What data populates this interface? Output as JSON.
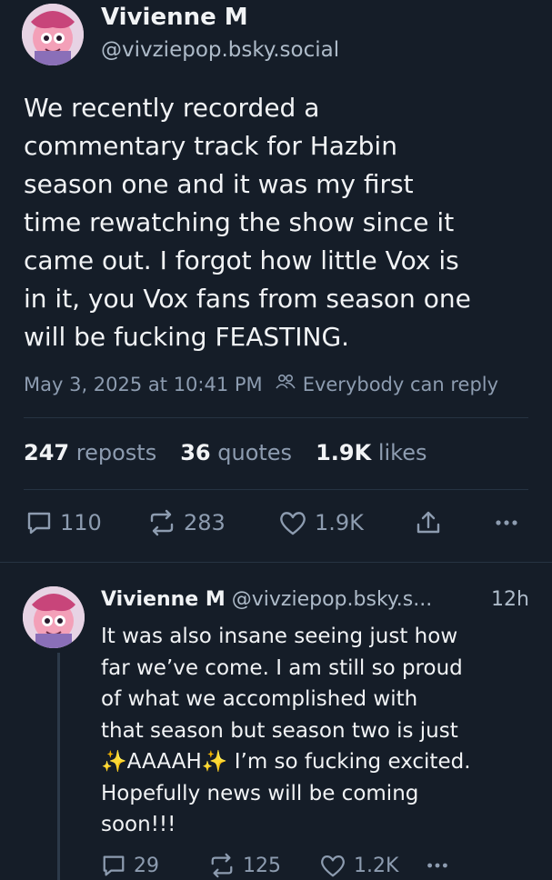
{
  "main_post": {
    "author_name": "Vivienne M",
    "author_handle": "@vivziepop.bsky.social",
    "text_lines": [
      "We recently recorded a",
      "commentary track for Hazbin",
      "season one and it was my first",
      "time rewatching the show since it",
      "came out. I forgot how little Vox is",
      "in it, you Vox fans from season one",
      "will be fucking FEASTING."
    ],
    "timestamp": "May 3, 2025 at 10:41 PM",
    "reply_setting": "Everybody can reply",
    "stats": {
      "reposts_count": "247",
      "reposts_label": "reposts",
      "quotes_count": "36",
      "quotes_label": "quotes",
      "likes_count": "1.9K",
      "likes_label": "likes"
    },
    "actions": {
      "replies": "110",
      "reposts": "283",
      "likes": "1.9K"
    }
  },
  "reply_post": {
    "author_name": "Vivienne M",
    "author_handle": "@vivziepop.bsky.s...",
    "age": "12h",
    "text_lines": [
      "It was also insane seeing just how",
      "far we’ve come. I am still so proud",
      "of what we accomplished with",
      "that season but season two is just"
    ],
    "line5_sparkle": "✨",
    "line5_shout": "AAAAH",
    "line5_rest": " I’m so fucking excited.",
    "text_lines_end": [
      "Hopefully news will be coming",
      "soon!!!"
    ],
    "actions": {
      "replies": "29",
      "reposts": "125",
      "likes": "1.2K"
    }
  },
  "icons": {
    "reply": "speech-bubble-icon",
    "repost": "repost-arrows-icon",
    "like": "heart-icon",
    "share": "share-icon",
    "more": "more-dots-icon",
    "people": "people-icon"
  }
}
